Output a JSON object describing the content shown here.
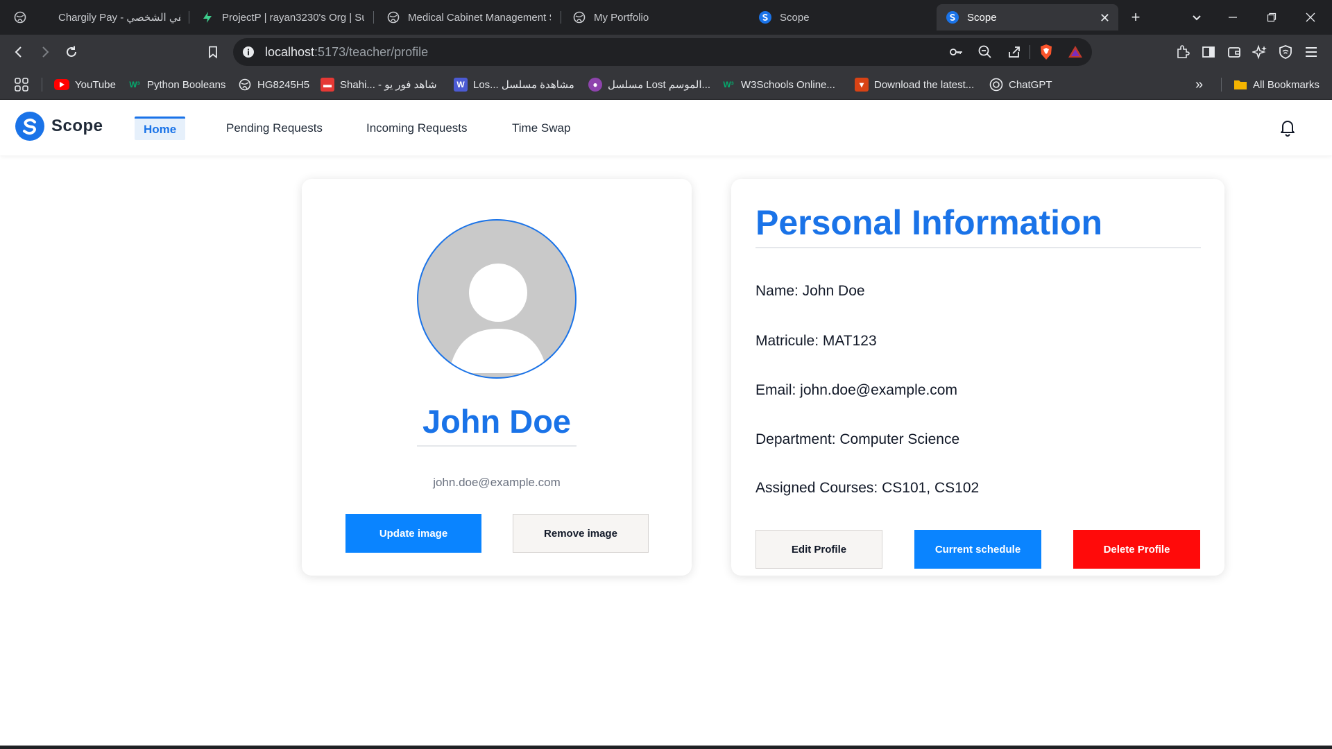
{
  "browser": {
    "tabs": [
      {
        "title": "Chargily Pay - ملفي الشخصي",
        "icon": "globe-icon"
      },
      {
        "title": "ProjectP | rayan3230's Org | Su",
        "icon": "supabase-icon"
      },
      {
        "title": "Medical Cabinet Management S",
        "icon": "globe-icon"
      },
      {
        "title": "My Portfolio",
        "icon": "globe-icon"
      },
      {
        "title": "Scope",
        "icon": "scope-icon"
      },
      {
        "title": "Scope",
        "icon": "scope-icon",
        "active": true
      }
    ],
    "url_host": "localhost",
    "url_path": ":5173/teacher/profile",
    "bookmarks": [
      {
        "label": "YouTube",
        "icon": "youtube-icon"
      },
      {
        "label": "Python Booleans",
        "icon": "w3-icon"
      },
      {
        "label": "HG8245H5",
        "icon": "globe-icon"
      },
      {
        "label": "Shahi... - شاهد فور يو",
        "icon": "shahid-icon"
      },
      {
        "label": "Los... مشاهدة مسلسل",
        "icon": "w-icon"
      },
      {
        "label": "مسلسل Lost الموسم...",
        "icon": "film-icon"
      },
      {
        "label": "W3Schools Online...",
        "icon": "w3-icon"
      },
      {
        "label": "Download the latest...",
        "icon": "download-icon"
      },
      {
        "label": "ChatGPT",
        "icon": "chatgpt-icon"
      }
    ],
    "all_bookmarks": "All Bookmarks",
    "more_bookmarks": "»"
  },
  "app": {
    "logo_text": "Scope",
    "nav": {
      "home": "Home",
      "pending": "Pending Requests",
      "incoming": "Incoming Requests",
      "swap": "Time Swap"
    }
  },
  "profile": {
    "name": "John Doe",
    "email": "john.doe@example.com",
    "update_image": "Update image",
    "remove_image": "Remove image"
  },
  "info": {
    "title": "Personal Information",
    "name_line": "Name: John Doe",
    "matricule_line": "Matricule: MAT123",
    "email_line": "Email: john.doe@example.com",
    "department_line": "Department: Computer Science",
    "courses_line": "Assigned Courses: CS101, CS102",
    "edit_profile": "Edit Profile",
    "current_schedule": "Current schedule",
    "delete_profile": "Delete Profile"
  },
  "colors": {
    "accent": "#1a73e8",
    "primary_button": "#0a84ff",
    "danger_button": "#ff0a0a"
  }
}
